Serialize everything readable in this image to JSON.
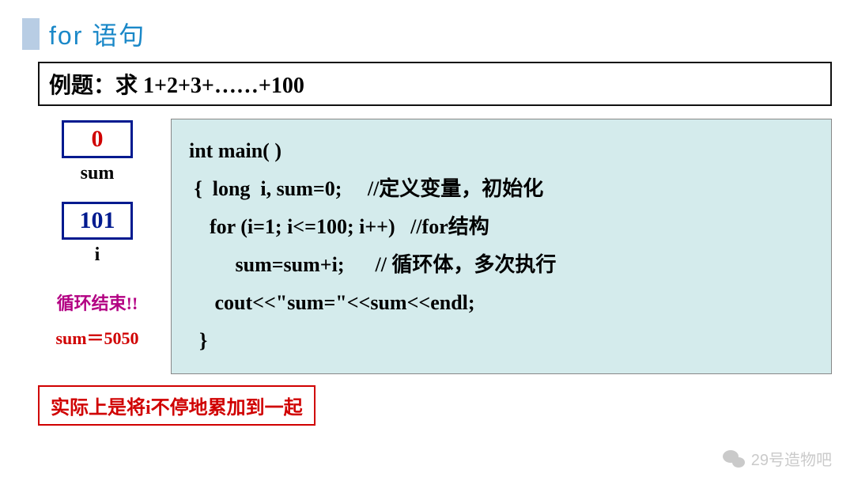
{
  "title": "for  语句",
  "problem": "例题：求 1+2+3+……+100",
  "vars": {
    "sum_box": "0",
    "sum_label": "sum",
    "i_box": "101",
    "i_label": "i"
  },
  "loop_end": "循环结束!!",
  "sum_result": "sum＝5050",
  "code": {
    "l1": "int main( )",
    "l2": " {  long  i, sum=0;     //定义变量，初始化",
    "l3": "    for (i=1; i<=100; i++)   //for结构",
    "l4": "         sum=sum+i;      // 循环体，多次执行",
    "l5": "     cout<<\"sum=\"<<sum<<endl;",
    "l6": "  }"
  },
  "note": "实际上是将i不停地累加到一起",
  "watermark": "29号造物吧"
}
